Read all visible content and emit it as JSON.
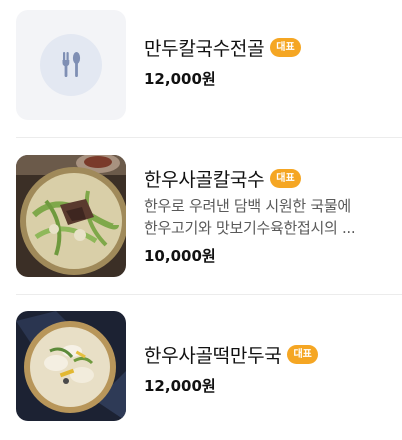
{
  "menu": {
    "items": [
      {
        "name": "만두칼국수전골",
        "badge": "대표",
        "description_lines": [],
        "price": "12,000원",
        "image": "fork-spoon-placeholder-icon"
      },
      {
        "name": "한우사골칼국수",
        "badge": "대표",
        "description_lines": [
          "한우로 우려낸 담백 시원한 국물에",
          "한우고기와 맛보기수육한접시의 ..."
        ],
        "price": "10,000원",
        "image": "kalguksu-hotpot-photo"
      },
      {
        "name": "한우사골떡만두국",
        "badge": "대표",
        "description_lines": [],
        "price": "12,000원",
        "image": "tteok-mandu-soup-photo"
      }
    ]
  },
  "colors": {
    "badge": "#f5a623",
    "placeholder_bg": "#f3f4f7",
    "placeholder_icon": "#7f8fb4"
  }
}
